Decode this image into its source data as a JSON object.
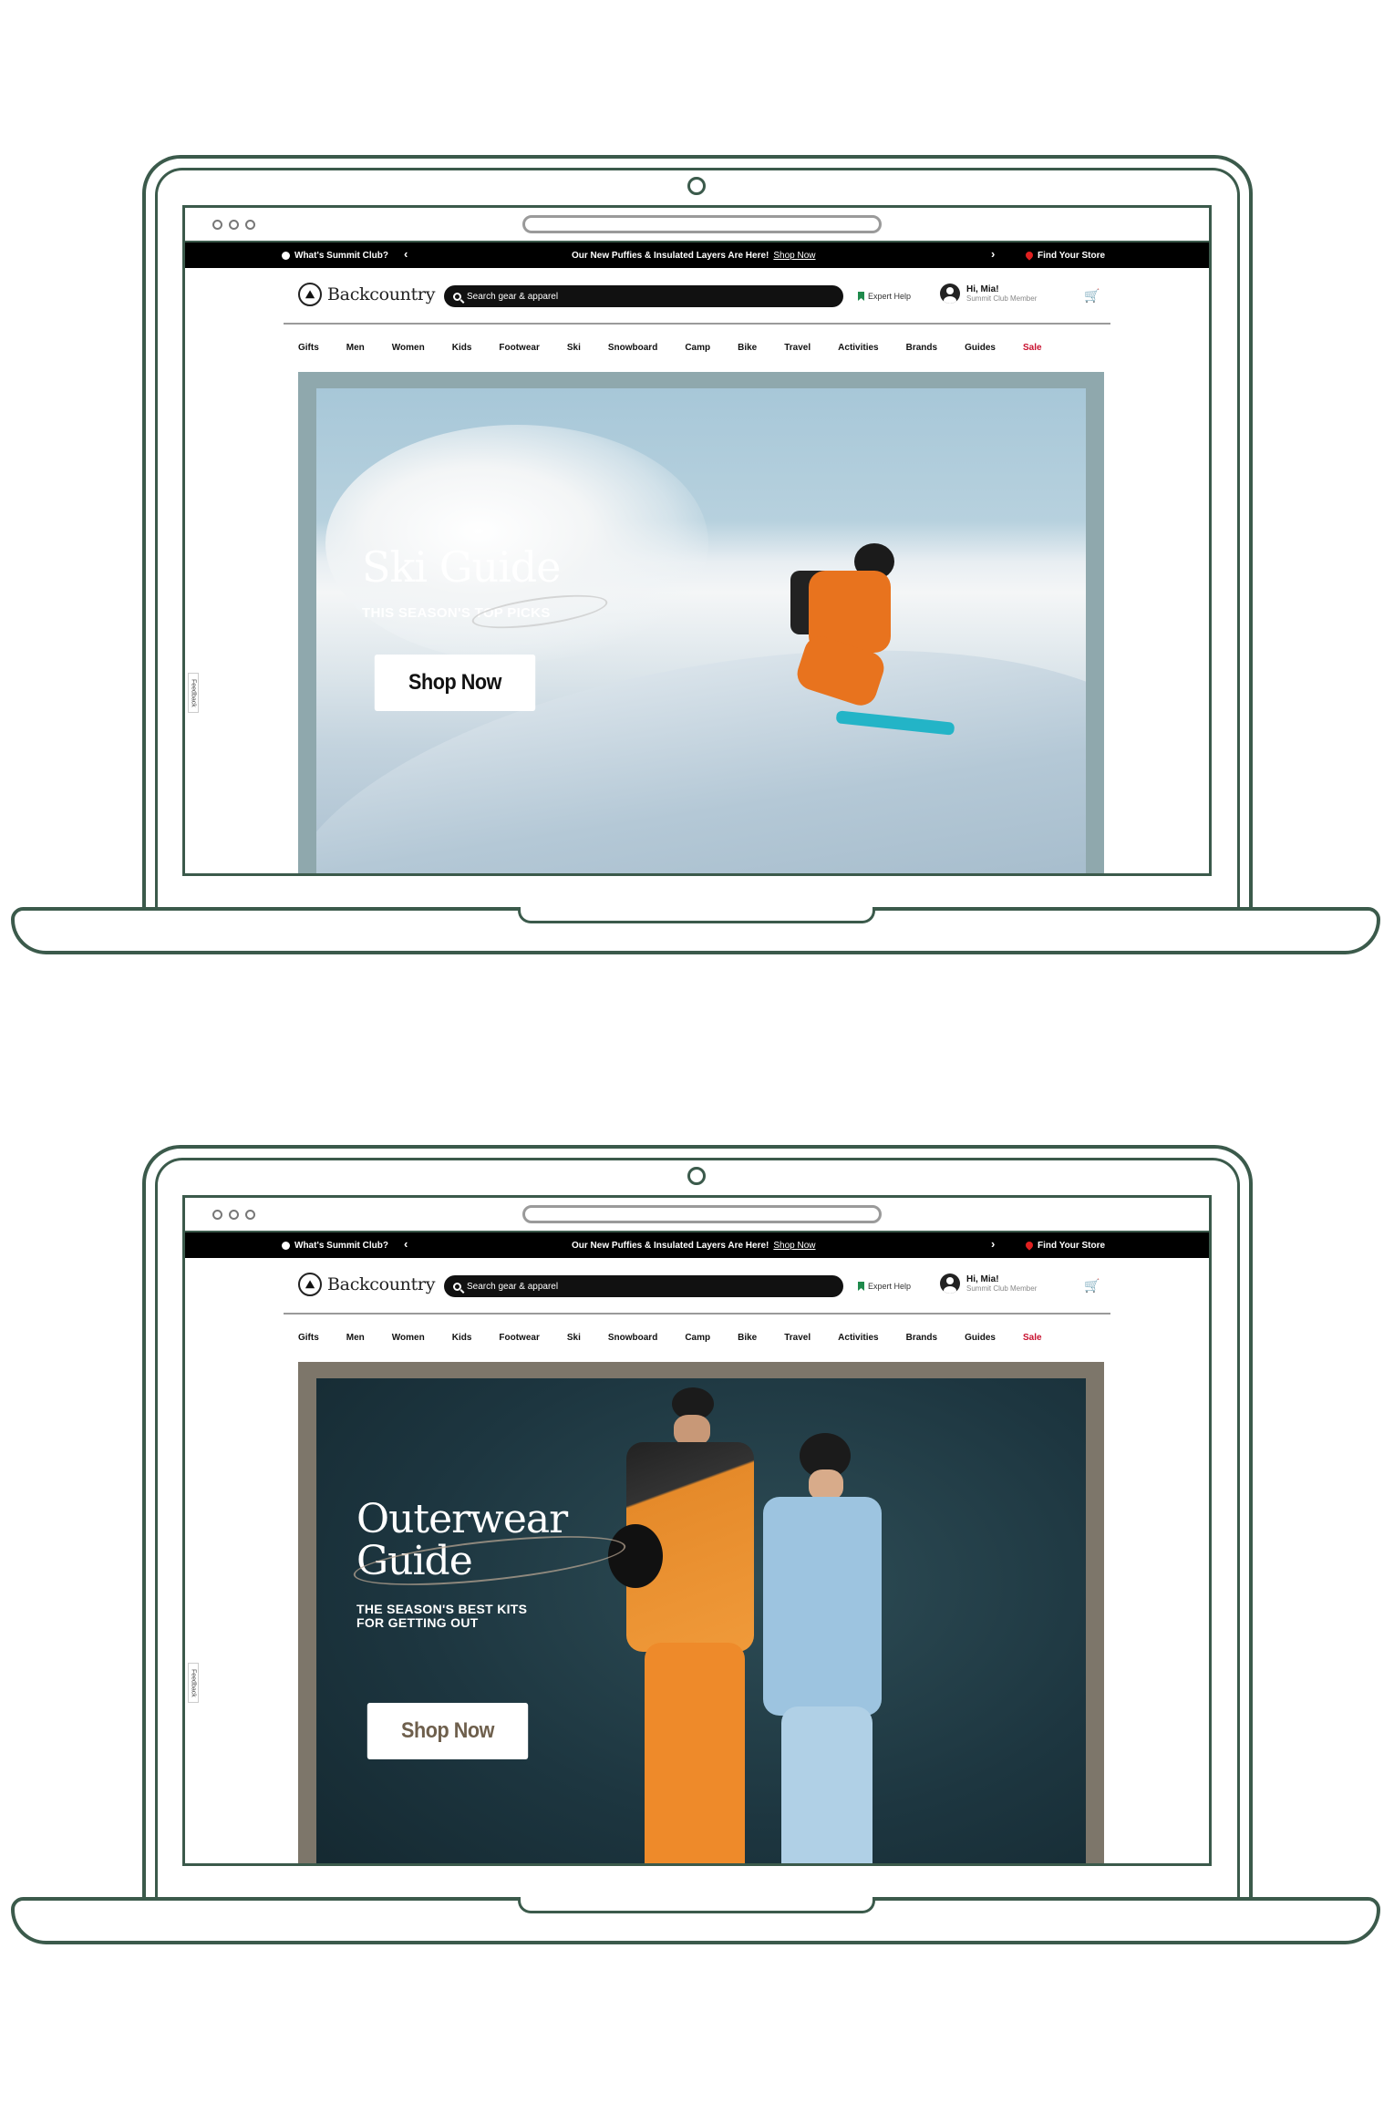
{
  "screens": [
    {
      "promo": {
        "left": "What's Summit Club?",
        "center_text": "Our New Puffies & Insulated Layers Are Here!",
        "center_link": "Shop Now",
        "right": "Find Your Store"
      },
      "header": {
        "logo": "Backcountry",
        "search_placeholder": "Search gear & apparel",
        "expert": "Expert Help",
        "greeting": "Hi, Mia!",
        "tier": "Summit Club Member"
      },
      "nav": [
        "Gifts",
        "Men",
        "Women",
        "Kids",
        "Footwear",
        "Ski",
        "Snowboard",
        "Camp",
        "Bike",
        "Travel",
        "Activities",
        "Brands",
        "Guides",
        "Sale"
      ],
      "feedback": "Feedback",
      "hero": {
        "title_line1": "Ski Guide",
        "title_line2": "",
        "subtitle_line1": "THIS SEASON'S TOP PICKS",
        "subtitle_line2": "",
        "button": "Shop Now"
      }
    },
    {
      "promo": {
        "left": "What's Summit Club?",
        "center_text": "Our New Puffies & Insulated Layers Are Here!",
        "center_link": "Shop Now",
        "right": "Find Your Store"
      },
      "header": {
        "logo": "Backcountry",
        "search_placeholder": "Search gear & apparel",
        "expert": "Expert Help",
        "greeting": "Hi, Mia!",
        "tier": "Summit Club Member"
      },
      "nav": [
        "Gifts",
        "Men",
        "Women",
        "Kids",
        "Footwear",
        "Ski",
        "Snowboard",
        "Camp",
        "Bike",
        "Travel",
        "Activities",
        "Brands",
        "Guides",
        "Sale"
      ],
      "feedback": "Feedback",
      "hero": {
        "title_line1": "Outerwear",
        "title_line2": "Guide",
        "subtitle_line1": "THE SEASON'S BEST KITS",
        "subtitle_line2": "FOR GETTING OUT",
        "button": "Shop Now"
      }
    }
  ],
  "colors": {
    "frame": "#3b5a4b",
    "sale": "#c8102e",
    "promo_bar": "#000000",
    "bookmark": "#1f8a4c"
  }
}
